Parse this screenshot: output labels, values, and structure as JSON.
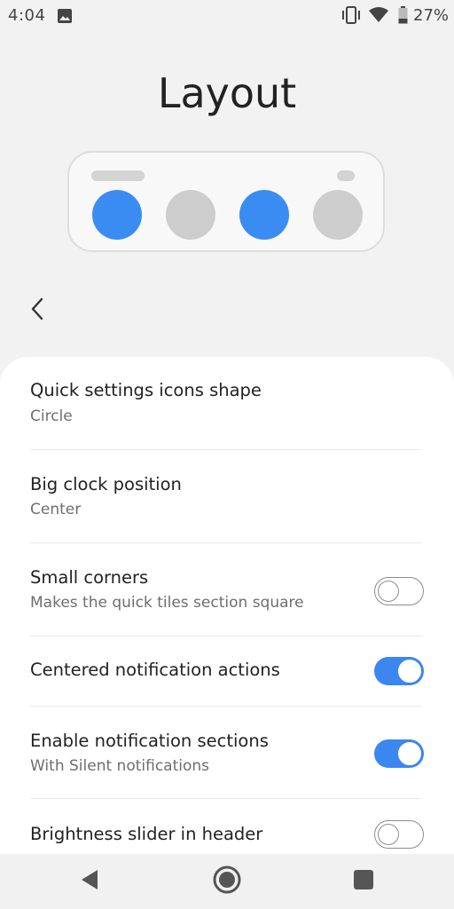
{
  "status_bar": {
    "time": "4:04",
    "battery": "27%"
  },
  "header": {
    "title": "Layout"
  },
  "preview": {
    "tile_colors": [
      "#3b8cf2",
      "#cdcdcd",
      "#3b8cf2",
      "#cdcdcd"
    ]
  },
  "colors": {
    "accent": "#3c86f0",
    "card": "#ffffff",
    "background": "#f2f2f2"
  },
  "settings": [
    {
      "title": "Quick settings icons shape",
      "summary": "Circle"
    },
    {
      "title": "Big clock position",
      "summary": "Center"
    },
    {
      "title": "Small corners",
      "summary": "Makes the quick tiles section square",
      "toggle": false
    },
    {
      "title": "Centered notification actions",
      "toggle": true
    },
    {
      "title": "Enable notification sections",
      "summary": "With Silent notifications",
      "toggle": true
    },
    {
      "title": "Brightness slider in header",
      "toggle": false
    }
  ],
  "icons": {
    "status": [
      "gallery-icon",
      "vibrate-icon",
      "wifi-icon",
      "battery-icon"
    ],
    "nav": [
      "back-icon",
      "home-icon",
      "recents-icon"
    ],
    "header": "chevron-left-icon"
  }
}
